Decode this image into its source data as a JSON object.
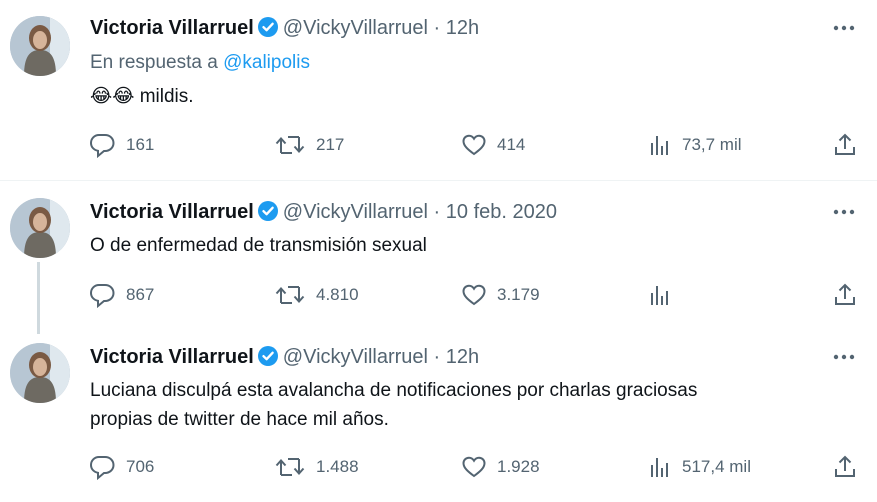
{
  "colors": {
    "accent": "#1d9bf0",
    "muted": "#536471",
    "text": "#0f1419"
  },
  "tweets": [
    {
      "name": "Victoria Villarruel",
      "handle": "@VickyVillarruel",
      "dot": "·",
      "time": "12h",
      "reply_prefix": "En respuesta a",
      "reply_to": "@kalipolis",
      "emoji": "😂😂",
      "text": "mildis.",
      "replies": "161",
      "retweets": "217",
      "likes": "414",
      "views": "73,7 mil"
    },
    {
      "name": "Victoria Villarruel",
      "handle": "@VickyVillarruel",
      "dot": "·",
      "time": "10 feb. 2020",
      "text": "O de enfermedad de transmisión sexual",
      "replies": "867",
      "retweets": "4.810",
      "likes": "3.179",
      "views": ""
    },
    {
      "name": "Victoria Villarruel",
      "handle": "@VickyVillarruel",
      "dot": "·",
      "time": "12h",
      "text_line1": "Luciana disculpá esta avalancha de notificaciones por charlas graciosas",
      "text_line2": "propias de twitter de hace mil años.",
      "replies": "706",
      "retweets": "1.488",
      "likes": "1.928",
      "views": "517,4 mil"
    }
  ]
}
